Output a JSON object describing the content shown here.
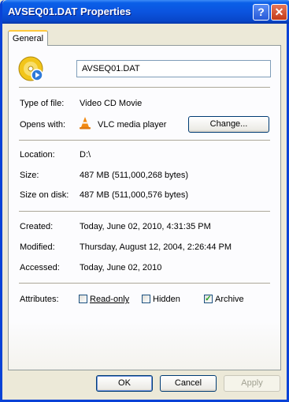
{
  "window": {
    "title": "AVSEQ01.DAT Properties",
    "help_glyph": "?",
    "close_glyph": "✕"
  },
  "tabs": [
    {
      "label": "General",
      "selected": true
    }
  ],
  "file": {
    "icon": "video-cd-disc-icon",
    "name_value": "AVSEQ01.DAT"
  },
  "type_section": {
    "type_label": "Type of file:",
    "type_value": "Video CD Movie",
    "opens_label": "Opens with:",
    "opens_icon": "vlc-cone-icon",
    "opens_value": "VLC media player",
    "change_button": "Change..."
  },
  "location_section": {
    "location_label": "Location:",
    "location_value": "D:\\",
    "size_label": "Size:",
    "size_value": "487 MB (511,000,268 bytes)",
    "size_disk_label": "Size on disk:",
    "size_disk_value": "487 MB (511,000,576 bytes)"
  },
  "dates_section": {
    "created_label": "Created:",
    "created_value": "Today, June 02, 2010, 4:31:35 PM",
    "modified_label": "Modified:",
    "modified_value": "Thursday, August 12, 2004, 2:26:44 PM",
    "accessed_label": "Accessed:",
    "accessed_value": "Today, June 02, 2010"
  },
  "attributes": {
    "label": "Attributes:",
    "readonly": {
      "label": "Read-only",
      "checked": false
    },
    "hidden": {
      "label": "Hidden",
      "checked": false
    },
    "archive": {
      "label": "Archive",
      "checked": true
    }
  },
  "footer": {
    "ok": "OK",
    "cancel": "Cancel",
    "apply": "Apply"
  },
  "colors": {
    "titlebar": "#0A5FE8",
    "face": "#ECE9D8",
    "tab_highlight": "#FFC83C",
    "checkmark": "#21A121"
  }
}
